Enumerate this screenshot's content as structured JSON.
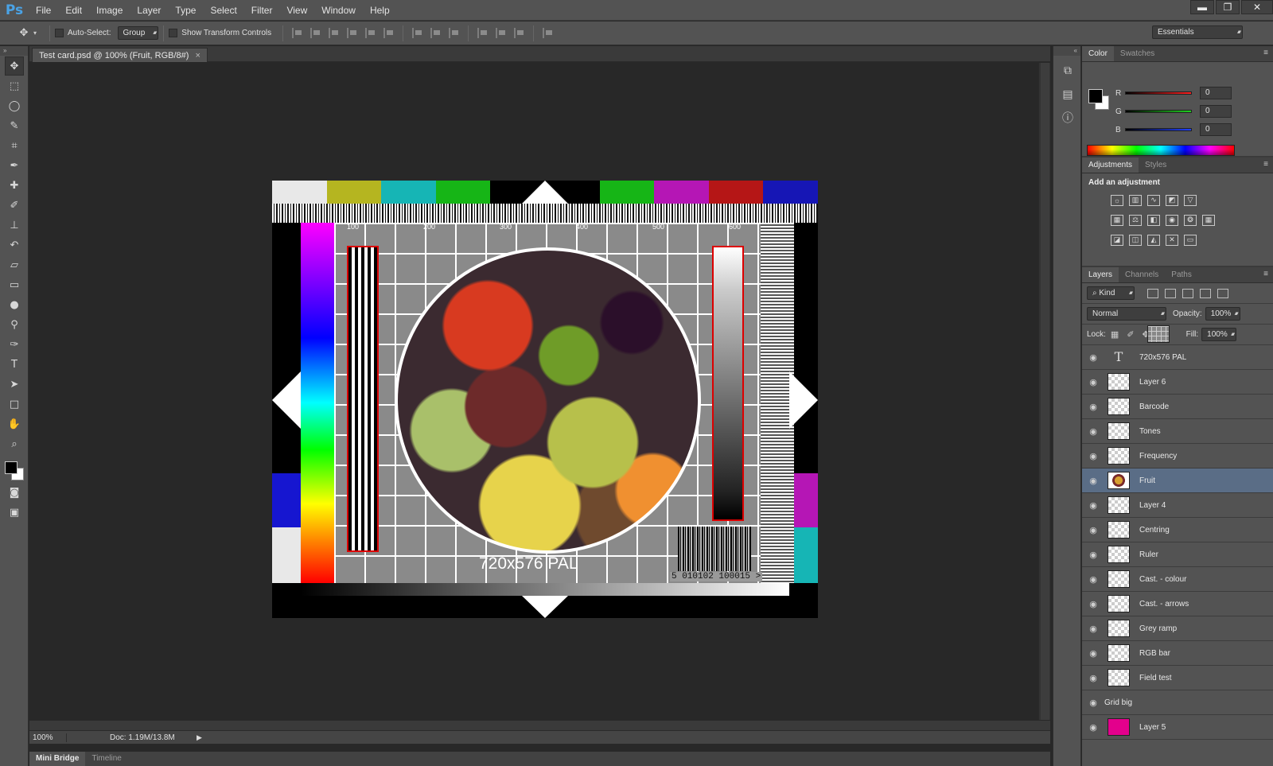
{
  "app": {
    "logo": "Ps"
  },
  "menu": [
    "File",
    "Edit",
    "Image",
    "Layer",
    "Type",
    "Select",
    "Filter",
    "View",
    "Window",
    "Help"
  ],
  "window_controls": {
    "minimize": "▬",
    "restore": "❐",
    "close": "✕"
  },
  "options": {
    "auto_select_label": "Auto-Select:",
    "auto_select_value": "Group",
    "transform_label": "Show Transform Controls",
    "workspace": "Essentials"
  },
  "document": {
    "tab_title": "Test card.psd @ 100% (Fruit, RGB/8#)",
    "tab_close": "×"
  },
  "testcard": {
    "title": "720x576 PAL",
    "barcode_number": "5 010102 100015 >",
    "ruler": [
      "100",
      "200",
      "300",
      "400",
      "500",
      "600"
    ],
    "top_bars": [
      "#e8e8e8",
      "#b5b520",
      "#16b5b5",
      "#16b516",
      "#000000",
      "#000000",
      "#16b516",
      "#b516b5",
      "#b51616",
      "#1616b5"
    ]
  },
  "status": {
    "zoom": "100%",
    "doc": "Doc: 1.19M/13.8M"
  },
  "bottom_tabs": [
    "Mini Bridge",
    "Timeline"
  ],
  "color_panel": {
    "tabs": [
      "Color",
      "Swatches"
    ],
    "channels": [
      {
        "label": "R",
        "value": "0",
        "color": "#ff2020"
      },
      {
        "label": "G",
        "value": "0",
        "color": "#20d020"
      },
      {
        "label": "B",
        "value": "0",
        "color": "#2040ff"
      }
    ]
  },
  "adjustments_panel": {
    "tabs": [
      "Adjustments",
      "Styles"
    ],
    "title": "Add an adjustment"
  },
  "layers_panel": {
    "tabs": [
      "Layers",
      "Channels",
      "Paths"
    ],
    "kind": "Kind",
    "blend_mode": "Normal",
    "opacity_label": "Opacity:",
    "opacity_value": "100%",
    "lock_label": "Lock:",
    "fill_label": "Fill:",
    "fill_value": "100%",
    "layers": [
      {
        "name": "720x576 PAL",
        "thumb": "text",
        "selected": false
      },
      {
        "name": "Layer 6",
        "thumb": "checker",
        "selected": false
      },
      {
        "name": "Barcode",
        "thumb": "checker",
        "selected": false
      },
      {
        "name": "Tones",
        "thumb": "checker",
        "selected": false
      },
      {
        "name": "Frequency",
        "thumb": "checker",
        "selected": false
      },
      {
        "name": "Fruit",
        "thumb": "fruit",
        "selected": true
      },
      {
        "name": "Layer 4",
        "thumb": "checker",
        "selected": false
      },
      {
        "name": "Centring",
        "thumb": "checker",
        "selected": false
      },
      {
        "name": "Ruler",
        "thumb": "checker",
        "selected": false
      },
      {
        "name": "Cast. - colour",
        "thumb": "checker",
        "selected": false
      },
      {
        "name": "Cast. - arrows",
        "thumb": "checker",
        "selected": false
      },
      {
        "name": "Grey ramp",
        "thumb": "checker",
        "selected": false
      },
      {
        "name": "RGB bar",
        "thumb": "checker",
        "selected": false
      },
      {
        "name": "Field test",
        "thumb": "checker",
        "selected": false
      },
      {
        "name": "Grid big",
        "thumb": "grid",
        "selected": false
      },
      {
        "name": "Layer 5",
        "thumb": "pink",
        "selected": false
      }
    ]
  }
}
